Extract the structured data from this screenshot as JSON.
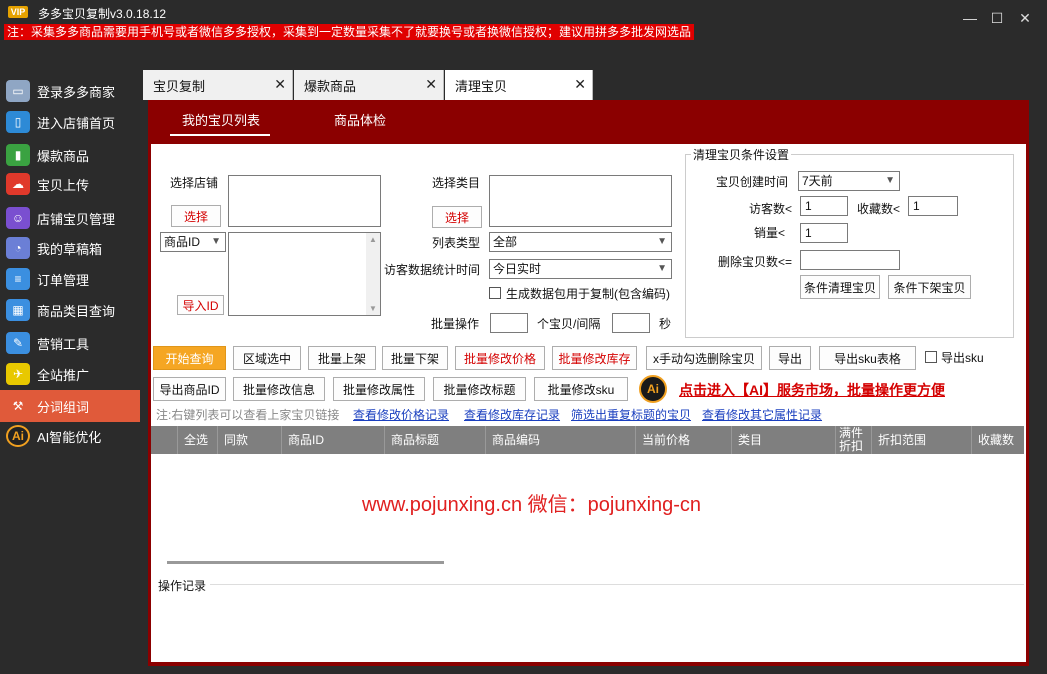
{
  "window": {
    "title": "多多宝贝复制v3.0.18.12",
    "vip_badge": "VIP",
    "notice": "注：采集多多商品需要用手机号或者微信多多授权，采集到一定数量采集不了就要换号或者换微信授权；建议用拼多多批发网选品",
    "controls": {
      "minimize": "—",
      "maximize": "☐",
      "close": "✕"
    }
  },
  "sidebar": {
    "items": [
      {
        "label": "登录多多商家",
        "icon": "monitor-icon",
        "color": "#8fa6c4"
      },
      {
        "label": "进入店铺首页",
        "icon": "phone-icon",
        "color": "#2d8ad6"
      },
      {
        "label": "爆款商品",
        "icon": "bar-chart-icon",
        "color": "#3aa241"
      },
      {
        "label": "宝贝上传",
        "icon": "cloud-upload-icon",
        "color": "#e0392b"
      },
      {
        "label": "店铺宝贝管理",
        "icon": "user-icon",
        "color": "#7a4fd0"
      },
      {
        "label": "我的草稿箱",
        "icon": "pie-chart-icon",
        "color": "#6b7fd6"
      },
      {
        "label": "订单管理",
        "icon": "order-icon",
        "color": "#3b8fe0"
      },
      {
        "label": "商品类目查询",
        "icon": "grid-icon",
        "color": "#3b8fe0"
      },
      {
        "label": "营销工具",
        "icon": "tools-icon",
        "color": "#3b8fe0"
      },
      {
        "label": "全站推广",
        "icon": "promo-icon",
        "color": "#e8c800"
      },
      {
        "label": "分词组词",
        "icon": "hammer-icon",
        "color": "#e05a3a"
      },
      {
        "label": "AI智能优化",
        "icon": "ai-icon",
        "color": "#222222"
      }
    ]
  },
  "tabs": [
    {
      "label": "宝贝复制",
      "close": "✕"
    },
    {
      "label": "爆款商品",
      "close": "✕"
    },
    {
      "label": "清理宝贝",
      "close": "✕"
    }
  ],
  "inner_tabs": {
    "my_list": "我的宝贝列表",
    "check": "商品体检"
  },
  "form": {
    "select_shop_label": "选择店铺",
    "select_shop_button": "选择",
    "select_category_label": "选择类目",
    "select_category_button": "选择",
    "id_type_value": "商品ID",
    "import_id_button": "导入ID",
    "list_type_label": "列表类型",
    "list_type_value": "全部",
    "visitor_stat_label": "访客数据统计时间",
    "visitor_stat_value": "今日实时",
    "gen_data_checkbox": "生成数据包用于复制(包含编码)",
    "batch_label": "批量操作",
    "per_interval_label": "个宝贝/间隔",
    "seconds_label": "秒"
  },
  "settings": {
    "title": "清理宝贝条件设置",
    "created_time_label": "宝贝创建时间",
    "created_time_value": "7天前",
    "visitors_label": "访客数<",
    "visitors_value": "1",
    "favorites_label": "收藏数<",
    "favorites_value": "1",
    "sales_label": "销量<",
    "sales_value": "1",
    "delete_count_label": "删除宝贝数<=",
    "delete_count_value": "",
    "condition_clean_button": "条件清理宝贝",
    "condition_offshelf_button": "条件下架宝贝"
  },
  "toolbar": {
    "start_query": "开始查询",
    "area_select": "区域选中",
    "batch_onshelf": "批量上架",
    "batch_offshelf": "批量下架",
    "batch_price": "批量修改价格",
    "batch_stock": "批量修改库存",
    "manual_delete": "x手动勾选删除宝贝",
    "export": "导出",
    "export_sku_table": "导出sku表格",
    "export_sku_checkbox": "导出sku",
    "export_ids": "导出商品ID",
    "batch_info": "批量修改信息",
    "batch_attr": "批量修改属性",
    "batch_title": "批量修改标题",
    "batch_sku": "批量修改sku",
    "ai_promo": "点击进入【AI】服务市场，批量操作更方便",
    "ai_badge": "Ai"
  },
  "links": {
    "note": "注:右键列表可以查看上家宝贝链接",
    "price_log": "查看修改价格记录",
    "stock_log": "查看修改库存记录",
    "dup_title": "筛选出重复标题的宝贝",
    "other_attr_log": "查看修改其它属性记录"
  },
  "table": {
    "columns": [
      "全选",
      "同款",
      "商品ID",
      "商品标题",
      "商品编码",
      "当前价格",
      "类目",
      "满件折扣",
      "折扣范围",
      "收藏数"
    ],
    "rows": []
  },
  "watermark": "www.pojunxing.cn   微信：pojunxing-cn",
  "oplog": {
    "title": "操作记录"
  },
  "colors": {
    "frame": "#8b0000",
    "accent": "#f5a623",
    "active_sidebar": "#e05a3a",
    "notice": "#e00000"
  }
}
